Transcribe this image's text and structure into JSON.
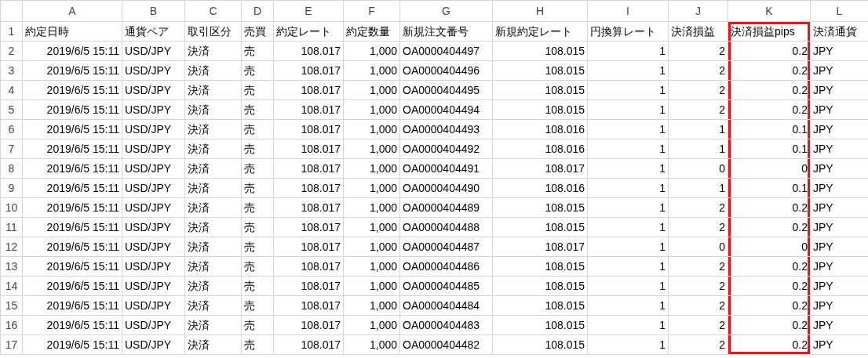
{
  "columns": [
    {
      "letter": "A",
      "kind": "number",
      "highlighted": false
    },
    {
      "letter": "B",
      "kind": "text",
      "highlighted": false
    },
    {
      "letter": "C",
      "kind": "text",
      "highlighted": false
    },
    {
      "letter": "D",
      "kind": "text",
      "highlighted": false
    },
    {
      "letter": "E",
      "kind": "number",
      "highlighted": false
    },
    {
      "letter": "F",
      "kind": "number",
      "highlighted": false
    },
    {
      "letter": "G",
      "kind": "text",
      "highlighted": false
    },
    {
      "letter": "H",
      "kind": "number",
      "highlighted": false
    },
    {
      "letter": "I",
      "kind": "number",
      "highlighted": false
    },
    {
      "letter": "J",
      "kind": "number",
      "highlighted": false
    },
    {
      "letter": "K",
      "kind": "number",
      "highlighted": true
    },
    {
      "letter": "L",
      "kind": "text",
      "highlighted": false
    }
  ],
  "rows": [
    {
      "number": "1",
      "cells": [
        "約定日時",
        "通貨ペア",
        "取引区分",
        "売買",
        "約定レート",
        "約定数量",
        "新規注文番号",
        "新規約定レート",
        "円換算レート",
        "決済損益",
        "決済損益pips",
        "決済通貨"
      ]
    },
    {
      "number": "2",
      "cells": [
        "2019/6/5 15:11",
        "USD/JPY",
        "決済",
        "売",
        "108.017",
        "1,000",
        "OA0000404497",
        "108.015",
        "1",
        "2",
        "0.2",
        "JPY"
      ]
    },
    {
      "number": "3",
      "cells": [
        "2019/6/5 15:11",
        "USD/JPY",
        "決済",
        "売",
        "108.017",
        "1,000",
        "OA0000404496",
        "108.015",
        "1",
        "2",
        "0.2",
        "JPY"
      ]
    },
    {
      "number": "4",
      "cells": [
        "2019/6/5 15:11",
        "USD/JPY",
        "決済",
        "売",
        "108.017",
        "1,000",
        "OA0000404495",
        "108.015",
        "1",
        "2",
        "0.2",
        "JPY"
      ]
    },
    {
      "number": "5",
      "cells": [
        "2019/6/5 15:11",
        "USD/JPY",
        "決済",
        "売",
        "108.017",
        "1,000",
        "OA0000404494",
        "108.015",
        "1",
        "2",
        "0.2",
        "JPY"
      ]
    },
    {
      "number": "6",
      "cells": [
        "2019/6/5 15:11",
        "USD/JPY",
        "決済",
        "売",
        "108.017",
        "1,000",
        "OA0000404493",
        "108.016",
        "1",
        "1",
        "0.1",
        "JPY"
      ]
    },
    {
      "number": "7",
      "cells": [
        "2019/6/5 15:11",
        "USD/JPY",
        "決済",
        "売",
        "108.017",
        "1,000",
        "OA0000404492",
        "108.016",
        "1",
        "1",
        "0.1",
        "JPY"
      ]
    },
    {
      "number": "8",
      "cells": [
        "2019/6/5 15:11",
        "USD/JPY",
        "決済",
        "売",
        "108.017",
        "1,000",
        "OA0000404491",
        "108.017",
        "1",
        "0",
        "0",
        "JPY"
      ]
    },
    {
      "number": "9",
      "cells": [
        "2019/6/5 15:11",
        "USD/JPY",
        "決済",
        "売",
        "108.017",
        "1,000",
        "OA0000404490",
        "108.016",
        "1",
        "1",
        "0.1",
        "JPY"
      ]
    },
    {
      "number": "10",
      "cells": [
        "2019/6/5 15:11",
        "USD/JPY",
        "決済",
        "売",
        "108.017",
        "1,000",
        "OA0000404489",
        "108.015",
        "1",
        "2",
        "0.2",
        "JPY"
      ]
    },
    {
      "number": "11",
      "cells": [
        "2019/6/5 15:11",
        "USD/JPY",
        "決済",
        "売",
        "108.017",
        "1,000",
        "OA0000404488",
        "108.015",
        "1",
        "2",
        "0.2",
        "JPY"
      ]
    },
    {
      "number": "12",
      "cells": [
        "2019/6/5 15:11",
        "USD/JPY",
        "決済",
        "売",
        "108.017",
        "1,000",
        "OA0000404487",
        "108.017",
        "1",
        "0",
        "0",
        "JPY"
      ]
    },
    {
      "number": "13",
      "cells": [
        "2019/6/5 15:11",
        "USD/JPY",
        "決済",
        "売",
        "108.017",
        "1,000",
        "OA0000404486",
        "108.015",
        "1",
        "2",
        "0.2",
        "JPY"
      ]
    },
    {
      "number": "14",
      "cells": [
        "2019/6/5 15:11",
        "USD/JPY",
        "決済",
        "売",
        "108.017",
        "1,000",
        "OA0000404485",
        "108.015",
        "1",
        "2",
        "0.2",
        "JPY"
      ]
    },
    {
      "number": "15",
      "cells": [
        "2019/6/5 15:11",
        "USD/JPY",
        "決済",
        "売",
        "108.017",
        "1,000",
        "OA0000404484",
        "108.015",
        "1",
        "2",
        "0.2",
        "JPY"
      ]
    },
    {
      "number": "16",
      "cells": [
        "2019/6/5 15:11",
        "USD/JPY",
        "決済",
        "売",
        "108.017",
        "1,000",
        "OA0000404483",
        "108.015",
        "1",
        "2",
        "0.2",
        "JPY"
      ]
    },
    {
      "number": "17",
      "cells": [
        "2019/6/5 15:11",
        "USD/JPY",
        "決済",
        "売",
        "108.017",
        "1,000",
        "OA0000404482",
        "108.015",
        "1",
        "2",
        "0.2",
        "JPY"
      ]
    }
  ]
}
